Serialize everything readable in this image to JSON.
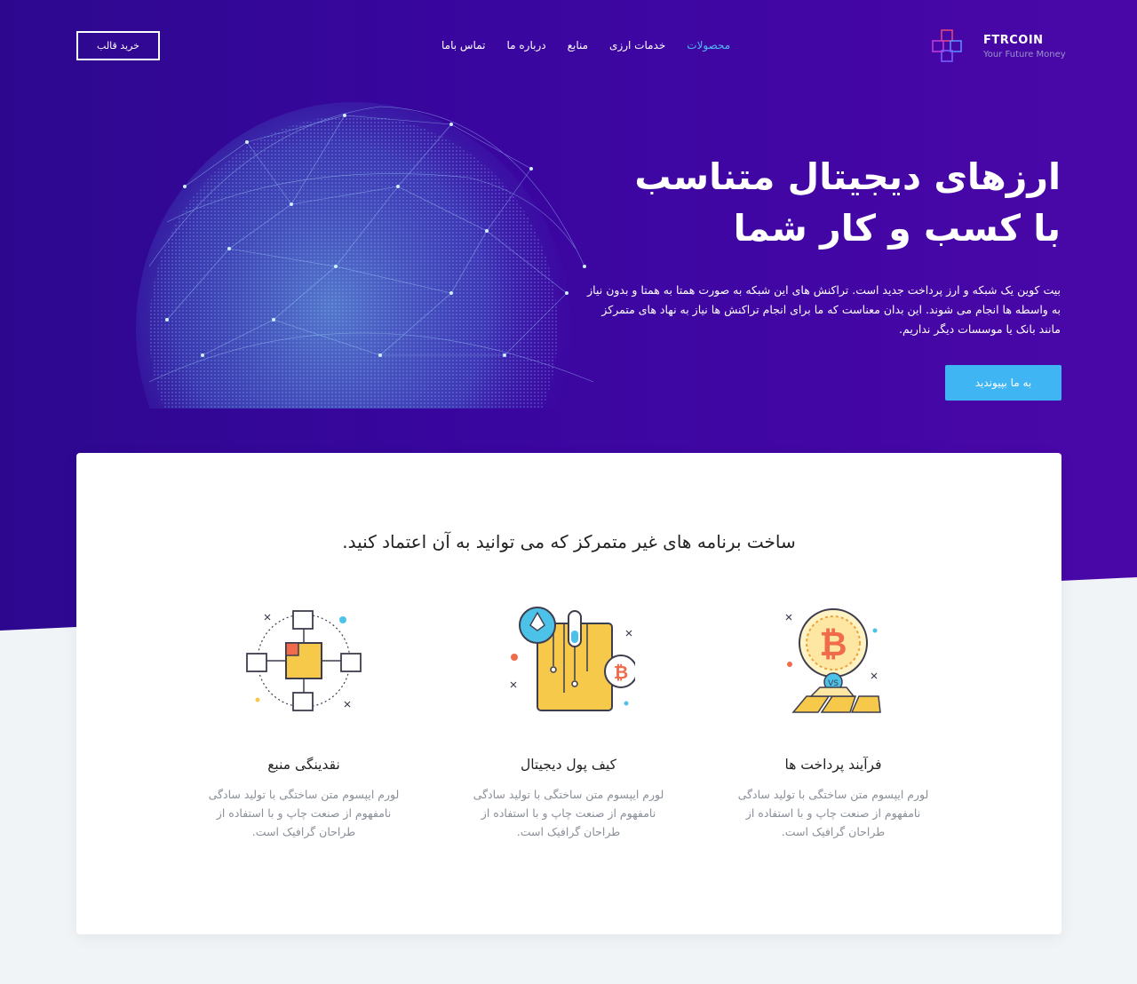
{
  "brand": {
    "name": "FTRCOIN",
    "tagline": "Your Future Money"
  },
  "nav": [
    {
      "label": "محصولات",
      "active": true
    },
    {
      "label": "خدمات ارزی",
      "active": false
    },
    {
      "label": "منابع",
      "active": false
    },
    {
      "label": "درباره ما",
      "active": false
    },
    {
      "label": "تماس باما",
      "active": false
    }
  ],
  "header": {
    "buy_label": "خرید قالب"
  },
  "hero": {
    "title_line1": "ارزهای دیجیتال متناسب",
    "title_line2": "با کسب و کار شما",
    "description": "بیت کوین یک شبکه و ارز پرداخت جدید است. تراکنش های این شبکه به صورت همتا به همتا و بدون نیاز به واسطه ها انجام می شوند. این بدان معناست که ما برای انجام تراکنش ها نیاز به نهاد های متمرکز مانند بانک یا موسسات دیگر نداریم.",
    "cta_label": "به ما بپیوندید"
  },
  "section": {
    "title": "ساخت برنامه های غیر متمرکز که می توانید به آن اعتماد کنید.",
    "features": [
      {
        "title": "فرآیند پرداخت ها",
        "icon": "bitcoin-vs-gold-icon",
        "desc": "لورم ایپسوم متن ساختگی با تولید سادگی نامفهوم از صنعت چاپ و با استفاده از طراحان گرافیک است."
      },
      {
        "title": "کیف پول دیجیتال",
        "icon": "crypto-wallet-icon",
        "desc": "لورم ایپسوم متن ساختگی با تولید سادگی نامفهوم از صنعت چاپ و با استفاده از طراحان گرافیک است."
      },
      {
        "title": "نقدینگی منبع",
        "icon": "blockchain-network-icon",
        "desc": "لورم ایپسوم متن ساختگی با تولید سادگی نامفهوم از صنعت چاپ و با استفاده از طراحان گرافیک است."
      }
    ]
  },
  "colors": {
    "accent": "#3fb6f3",
    "nav_active": "#4fb9f7",
    "hero_bg": "#3a06a0"
  }
}
